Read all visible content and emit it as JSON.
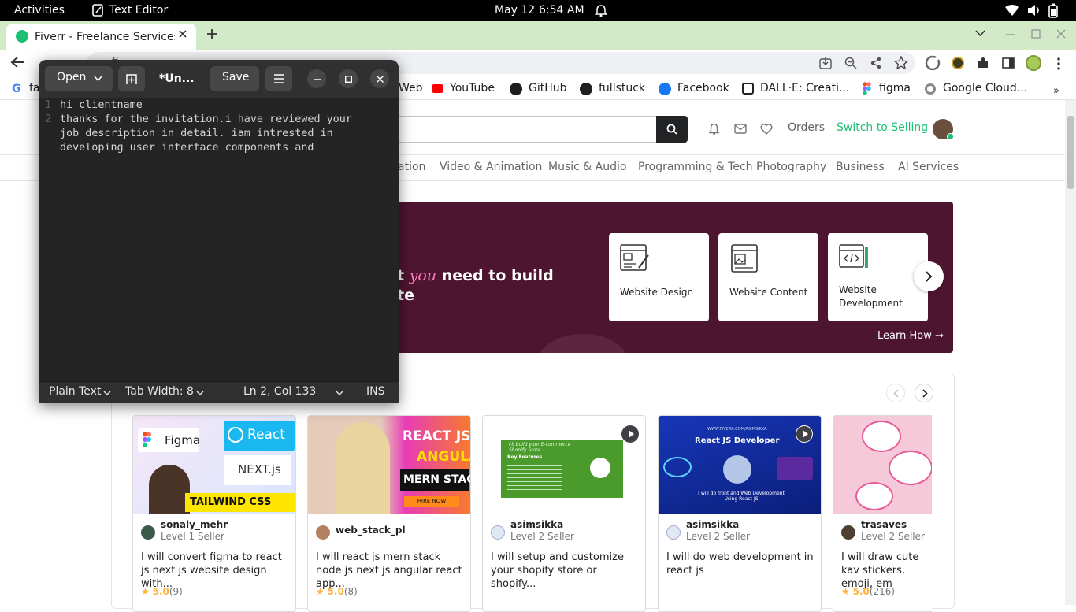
{
  "topbar": {
    "activities": "Activities",
    "app_name": "Text Editor",
    "date": "May 12",
    "time": "6:54 AM"
  },
  "browser": {
    "tab_title": "Fiverr - Freelance Services",
    "address_prefix": "fi",
    "bookmarks": [
      "fa",
      "Web",
      "YouTube",
      "GitHub",
      "fullstuck",
      "Facebook",
      "DALL·E: Creati...",
      "figma",
      "Google Cloud..."
    ]
  },
  "fiverr": {
    "header": {
      "orders": "Orders",
      "switch_selling": "Switch to Selling"
    },
    "categories": [
      "ation",
      "Video & Animation",
      "Music & Audio",
      "Programming & Tech",
      "Photography",
      "Business",
      "AI Services"
    ],
    "banner": {
      "line1_start": "t ",
      "line1_em": "you",
      "line1_end": " need to build",
      "line2": "te",
      "learn_how": "Learn How →",
      "cards": [
        "Website Design",
        "Website Content",
        "Website Development"
      ]
    },
    "gigs": [
      {
        "seller": "sonaly_mehr",
        "level": "Level 1 Seller",
        "title": "I will convert figma to react js next js website design with...",
        "rating": "5.0",
        "count": "(9)"
      },
      {
        "seller": "web_stack_pl",
        "level": "",
        "title": "I will react js mern stack node js next js angular react app...",
        "rating": "5.0",
        "count": "(8)"
      },
      {
        "seller": "asimsikka",
        "level": "Level 2 Seller",
        "title": "I will setup and customize your shopify store or shopify...",
        "rating": "",
        "count": ""
      },
      {
        "seller": "asimsikka",
        "level": "Level 2 Seller",
        "title": "I will do web development in react js",
        "rating": "",
        "count": ""
      },
      {
        "seller": "trasaves",
        "level": "Level 2 Seller",
        "title": "I will draw cute kav stickers, emoji, em",
        "rating": "5.0",
        "count": "(216)"
      }
    ],
    "gig_images": {
      "g1": {
        "figma": "Figma",
        "react": "React",
        "next": "NEXT.js",
        "tailwind": "TAILWIND CSS"
      },
      "g2": {
        "react": "REACT JS",
        "angular": "ANGULAR",
        "mern": "MERN STACK",
        "hire": "HIRE NOW"
      },
      "g3": {
        "headline": "I'll build your E-commerce Shopify Store",
        "features": "Key Features"
      },
      "g4": {
        "url": "WWW.FIVERR.COM/ASIMSIKKA",
        "headline": "React JS Developer",
        "sub": "I will do front and Web Development Using React JS"
      }
    }
  },
  "editor": {
    "open_label": "Open",
    "title": "*Un...",
    "save_label": "Save",
    "lines": [
      {
        "num": "1",
        "text": "hi clientname"
      },
      {
        "num": "2",
        "text": "thanks for the invitation.i have reviewed your"
      },
      {
        "num": "",
        "text": "job description in detail. iam intrested in"
      },
      {
        "num": "",
        "text": "developing user interface components and"
      }
    ],
    "status": {
      "language": "Plain Text",
      "tab_width": "Tab Width: 8",
      "position": "Ln 2, Col 133",
      "mode": "INS"
    }
  },
  "colors": {
    "fiverr_green": "#1dbf73",
    "banner_bg": "#4e1531",
    "chrome_tab_strip": "#d3eac8",
    "editor_bg": "#242424"
  }
}
